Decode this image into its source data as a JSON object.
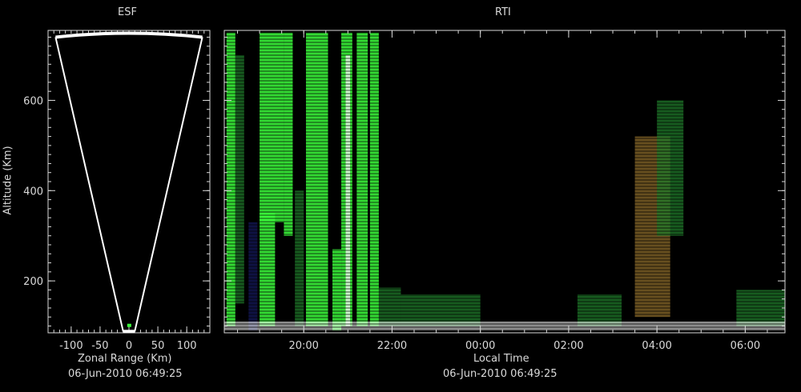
{
  "colors": {
    "background": "#000000",
    "axis": "#d9d9d9",
    "fan": "#ffffff",
    "echo_strong": "#ffffff",
    "echo_green": "#3cff3c",
    "echo_dark_green": "#1f7a2a",
    "echo_navy": "#14185a",
    "echo_brown": "#8a6a2a"
  },
  "chart_data": [
    {
      "type": "fan",
      "title": "ESF",
      "xlabel": "Zonal Range (Km)",
      "ylabel": "Altitude (Km)",
      "xlim": [
        -140,
        140
      ],
      "ylim": [
        85,
        755
      ],
      "x_ticks": [
        -100,
        -50,
        0,
        50,
        100
      ],
      "x_tick_labels": [
        "-100",
        "-50",
        "0",
        "50",
        "100"
      ],
      "y_ticks": [
        200,
        400,
        600
      ],
      "y_tick_labels": [
        "200",
        "400",
        "600"
      ],
      "fan": {
        "apex_altitude": 88,
        "top_altitude": 745,
        "top_left_x": -127,
        "top_right_x": 127,
        "bottom_left_x": -10,
        "bottom_right_x": 10
      },
      "timestamp": "06-Jun-2010 06:49:25"
    },
    {
      "type": "heatmap",
      "title": "RTI",
      "xlabel": "Local Time",
      "ylabel": "",
      "xlim": [
        18.2,
        30.9
      ],
      "ylim": [
        85,
        755
      ],
      "x_ticks": [
        20,
        22,
        24,
        26,
        28,
        30
      ],
      "x_tick_labels": [
        "20:00",
        "22:00",
        "00:00",
        "02:00",
        "04:00",
        "06:00"
      ],
      "y_ticks": [
        200,
        400,
        600
      ],
      "timestamp": "06-Jun-2010 06:49:25",
      "echo_regions": [
        {
          "x0": 18.25,
          "x1": 18.45,
          "y0": 100,
          "y1": 750,
          "color": "green"
        },
        {
          "x0": 18.45,
          "x1": 18.65,
          "y0": 150,
          "y1": 700,
          "color": "dark_green"
        },
        {
          "x0": 18.75,
          "x1": 18.95,
          "y0": 90,
          "y1": 330,
          "color": "navy"
        },
        {
          "x0": 19.0,
          "x1": 19.35,
          "y0": 100,
          "y1": 350,
          "color": "green"
        },
        {
          "x0": 19.0,
          "x1": 19.55,
          "y0": 330,
          "y1": 750,
          "color": "green"
        },
        {
          "x0": 19.55,
          "x1": 19.75,
          "y0": 300,
          "y1": 750,
          "color": "green"
        },
        {
          "x0": 19.8,
          "x1": 20.0,
          "y0": 100,
          "y1": 400,
          "color": "dark_green"
        },
        {
          "x0": 20.05,
          "x1": 20.55,
          "y0": 100,
          "y1": 750,
          "color": "green"
        },
        {
          "x0": 20.65,
          "x1": 20.85,
          "y0": 90,
          "y1": 270,
          "color": "green"
        },
        {
          "x0": 20.85,
          "x1": 21.1,
          "y0": 100,
          "y1": 750,
          "color": "green"
        },
        {
          "x0": 20.95,
          "x1": 21.05,
          "y0": 100,
          "y1": 700,
          "color": "white"
        },
        {
          "x0": 21.2,
          "x1": 21.45,
          "y0": 100,
          "y1": 750,
          "color": "green"
        },
        {
          "x0": 21.5,
          "x1": 21.7,
          "y0": 100,
          "y1": 750,
          "color": "green"
        },
        {
          "x0": 21.7,
          "x1": 22.2,
          "y0": 100,
          "y1": 185,
          "color": "dark_green"
        },
        {
          "x0": 22.2,
          "x1": 24.0,
          "y0": 100,
          "y1": 170,
          "color": "dark_green"
        },
        {
          "x0": 26.2,
          "x1": 27.2,
          "y0": 100,
          "y1": 170,
          "color": "dark_green"
        },
        {
          "x0": 27.5,
          "x1": 28.3,
          "y0": 120,
          "y1": 520,
          "color": "brown"
        },
        {
          "x0": 28.0,
          "x1": 28.6,
          "y0": 300,
          "y1": 600,
          "color": "dark_green"
        },
        {
          "x0": 29.8,
          "x1": 30.9,
          "y0": 100,
          "y1": 180,
          "color": "dark_green"
        }
      ],
      "bottom_band": {
        "y0": 90,
        "y1": 110,
        "color": "white"
      }
    }
  ],
  "labels": {
    "esf_title": "ESF",
    "rti_title": "RTI",
    "altitude_label": "Altitude (Km)",
    "zonal_label": "Zonal Range (Km)",
    "local_time_label": "Local Time",
    "esf_timestamp": "06-Jun-2010 06:49:25",
    "rti_timestamp": "06-Jun-2010 06:49:25"
  }
}
